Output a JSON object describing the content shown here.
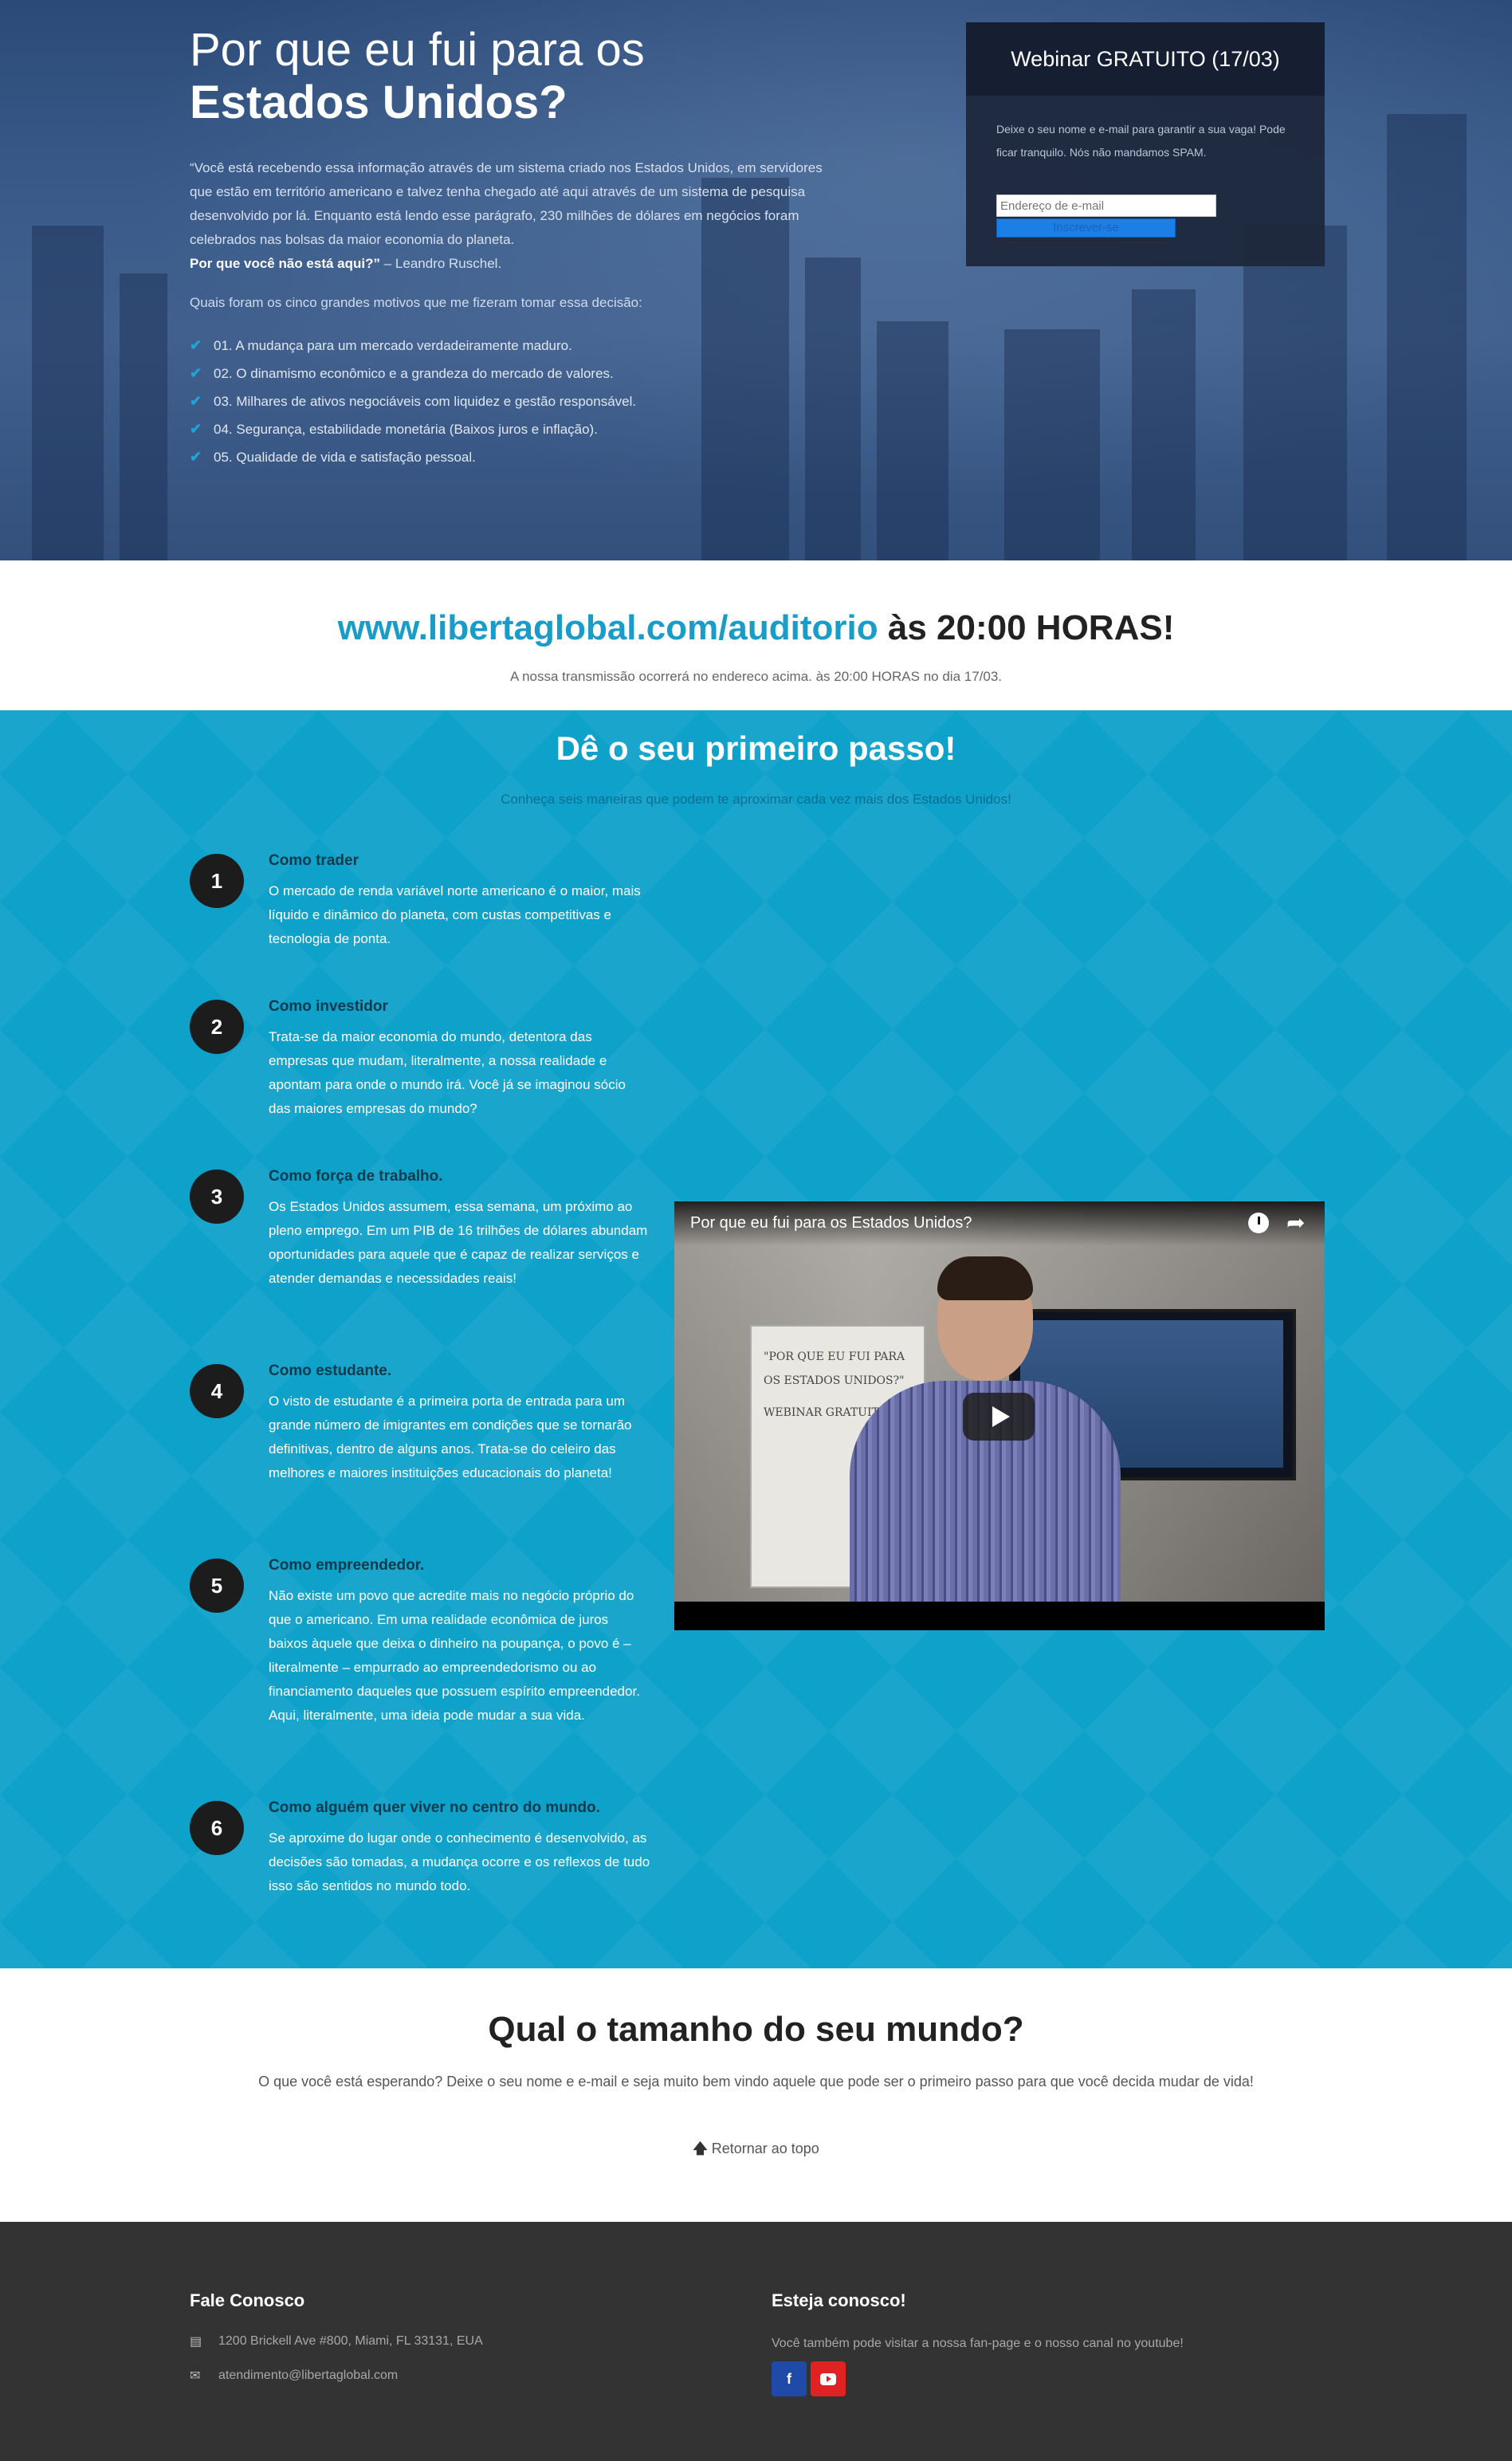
{
  "hero": {
    "title_line1": "Por que eu fui para os",
    "title_line2": "Estados Unidos?",
    "quote": "“Você está recebendo essa informação através de um sistema criado nos Estados Unidos, em servidores que estão em território americano e talvez tenha chegado até aqui através de um sistema de pesquisa desenvolvido por lá. Enquanto está lendo esse parágrafo, 230 milhões de dólares em negócios foram celebrados nas bolsas da maior economia do planeta.",
    "quote_question": "Por que você não está aqui?”",
    "quote_author": " – Leandro Ruschel.",
    "question": "Quais foram os cinco grandes motivos que me fizeram tomar essa decisão:",
    "reasons": [
      "01. A mudança para um mercado verdadeiramente maduro.",
      "02. O dinamismo econômico e a grandeza do mercado de valores.",
      "03. Milhares de ativos negociáveis com liquidez e gestão responsável.",
      "04. Segurança, estabilidade monetária (Baixos juros e inflação).",
      "05. Qualidade de vida e satisfação pessoal."
    ]
  },
  "webinar": {
    "title": "Webinar GRATUITO (17/03)",
    "text": "Deixe o seu nome e e-mail para garantir a sua vaga! Pode ficar tranquilo. Nós não mandamos SPAM.",
    "email_placeholder": "Endereço de e-mail",
    "button_label": "Inscrever-se"
  },
  "broadcast": {
    "url": "www.libertaglobal.com/auditorio",
    "time": " às 20:00 HORAS!",
    "note": "A nossa transmissão ocorrerá no endereco acima. às 20:00 HORAS no dia 17/03."
  },
  "steps_section": {
    "title": "Dê o seu primeiro passo!",
    "subtitle": "Conheça seis maneiras que podem te aproximar cada vez mais dos Estados Unidos!",
    "steps": [
      {
        "num": "1",
        "title": "Como trader",
        "text": "O mercado de renda variável norte americano é o maior, mais líquido e dinâmico do planeta, com custas competitivas e tecnologia de ponta."
      },
      {
        "num": "2",
        "title": "Como investidor",
        "text": "Trata-se da maior economia do mundo, detentora das empresas que mudam, literalmente, a nossa realidade e apontam para onde o mundo irá. Você já se imaginou sócio das maiores empresas do mundo?"
      },
      {
        "num": "3",
        "title": "Como força de trabalho.",
        "text": "Os Estados Unidos assumem, essa semana, um próximo ao pleno emprego. Em um PIB de 16 trilhões de dólares abundam oportunidades para aquele que é capaz de realizar serviços e atender demandas e necessidades reais!"
      },
      {
        "num": "4",
        "title": "Como estudante.",
        "text": "O visto de estudante é a primeira porta de entrada para um grande número de imigrantes em condições que se tornarão definitivas, dentro de alguns anos. Trata-se do celeiro das melhores e maiores instituições educacionais do planeta!"
      },
      {
        "num": "5",
        "title": "Como empreendedor.",
        "text": "Não existe um povo que acredite mais no negócio próprio do que o americano. Em uma realidade econômica de juros baixos àquele que deixa o dinheiro na poupança, o povo é – literalmente – empurrado ao empreendedorismo ou ao financiamento daqueles que possuem espírito empreendedor. Aqui, literalmente, uma ideia pode mudar a sua vida."
      },
      {
        "num": "6",
        "title": "Como alguém quer viver no centro do mundo.",
        "text": "Se aproxime do lugar onde o conhecimento é desenvolvido, as decisões são tomadas, a mudança ocorre e os reflexos de tudo isso são sentidos no mundo todo."
      }
    ]
  },
  "video": {
    "title": "Por que eu fui para os Estados Unidos?",
    "board_lines": [
      "\"POR QUE EU FUI PARA",
      "OS ESTADOS UNIDOS?\"",
      "WEBINAR GRATUITO"
    ]
  },
  "world": {
    "title": "Qual o tamanho do seu mundo?",
    "text": "O que você está esperando? Deixe o seu nome e e-mail e seja muito bem vindo aquele que pode ser o primeiro passo para que você decida mudar de vida!",
    "back_to_top": "Retornar ao topo"
  },
  "footer": {
    "contact_title": "Fale Conosco",
    "address": "1200 Brickell Ave #800, Miami, FL 33131, EUA",
    "email": "atendimento@libertaglobal.com",
    "social_title": "Esteja conosco!",
    "social_text": "Você também pode visitar a nossa fan-page e o nosso canal no youtube!",
    "facebook_glyph": "f"
  },
  "colors": {
    "accent_blue": "#0ea1c9",
    "url_blue": "#1a9cc8",
    "footer_bg": "#333333",
    "facebook": "#1f4aa8",
    "youtube": "#e02222"
  }
}
